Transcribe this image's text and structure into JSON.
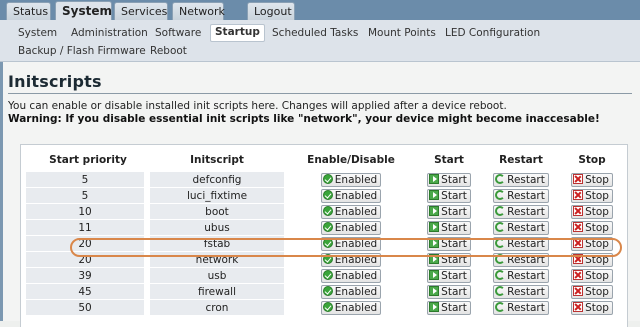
{
  "top_tabs": [
    "Status",
    "System",
    "Services",
    "Network",
    "Logout"
  ],
  "top_tab_active": "System",
  "subnav": {
    "row1": [
      "System",
      "Administration",
      "Software",
      "Startup",
      "Scheduled Tasks",
      "Mount Points",
      "LED Configuration"
    ],
    "row2": [
      "Backup / Flash Firmware",
      "Reboot"
    ],
    "active": "Startup"
  },
  "page": {
    "title": "Initscripts",
    "description": "You can enable or disable installed init scripts here. Changes will applied after a device reboot.",
    "warning": "Warning: If you disable essential init scripts like \"network\", your device might become inaccesable!"
  },
  "table": {
    "headers": [
      "Start priority",
      "Initscript",
      "Enable/Disable",
      "Start",
      "Restart",
      "Stop"
    ],
    "buttons": {
      "enabled": "Enabled",
      "start": "Start",
      "restart": "Restart",
      "stop": "Stop"
    },
    "rows": [
      {
        "priority": "5",
        "name": "defconfig"
      },
      {
        "priority": "5",
        "name": "luci_fixtime"
      },
      {
        "priority": "10",
        "name": "boot"
      },
      {
        "priority": "11",
        "name": "ubus"
      },
      {
        "priority": "20",
        "name": "fstab"
      },
      {
        "priority": "20",
        "name": "network"
      },
      {
        "priority": "39",
        "name": "usb"
      },
      {
        "priority": "45",
        "name": "firewall"
      },
      {
        "priority": "50",
        "name": "cron"
      }
    ],
    "highlighted_row": "fstab"
  },
  "colors": {
    "highlight_outline": "#d9874a",
    "nav_bar": "#6b8caa",
    "row_shade": "#e8ebef"
  }
}
